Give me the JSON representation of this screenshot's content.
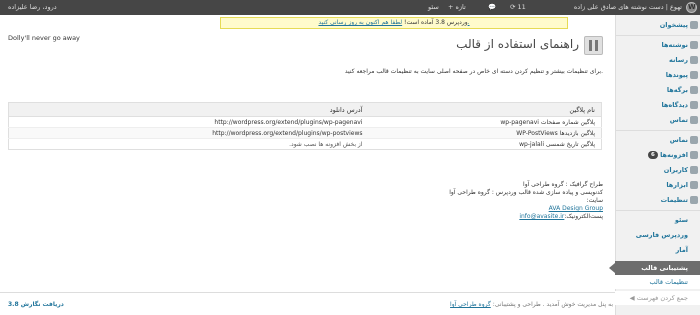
{
  "adminbar": {
    "site_name": "تهوع | دست نوشته های صادق علی زاده",
    "updates_count": "11",
    "new_label": "+ تازه",
    "seo_label": "سئو",
    "howdy": "درود، رضا علیزاده"
  },
  "notice": {
    "text": "وردپرس 3.8 آماده است!",
    "link": "لطفا هم اکنون به روز رسانی کنید."
  },
  "dolly": "Dolly'll never go away",
  "page_title": "راهنمای استفاده از قالب",
  "intro": "برای تنظیمات بیشتر و تنظیم کردن دسته ای خاص در صفحه اصلی سایت به تنظیمات قالب مراجعه کنید.",
  "table": {
    "headers": {
      "name": "نام پلاگین",
      "url": "آدرس دانلود"
    },
    "rows": [
      {
        "name": "پلاگین شماره صفحات wp-pagenavi",
        "url": "http://wordpress.org/extend/plugins/wp-pagenavi"
      },
      {
        "name": "پلاگین بازدیدها WP-PostViews",
        "url": "http://wordpress.org/extend/plugins/wp-postviews"
      },
      {
        "name": "پلاگین تاریخ شمسی wp-jalali",
        "note": "از بخش افزونه ها نصب شود."
      }
    ]
  },
  "credits": {
    "designer": "طراح گرافیک : گروه طراحی آوا",
    "coder": "کدنویسی و پیاده سازی شده قالب وردپرس : گروه طراحی آوا",
    "site_label": "سایت:",
    "site_link": "AVA Design Group",
    "email_label": "پست‌الکترونیک:",
    "email_link": "info@avasite.ir"
  },
  "menu": {
    "dashboard": "پیشخوان",
    "posts": "نوشته‌ها",
    "media": "رسانه",
    "links": "پیوندها",
    "pages": "برگه‌ها",
    "comments": "دیدگاه‌ها",
    "contact1": "تماس",
    "contact2": "نماس",
    "plugins": "افزونه‌ها",
    "plugins_badge": "6",
    "users": "کاربران",
    "tools": "ابزارها",
    "settings": "تنظیمات",
    "seo": "سئو",
    "wp_farsi": "وردپرس فارسی",
    "stats": "آمار",
    "theme_support": "پشتیبانی قالب",
    "theme_settings": "تنظیمات قالب",
    "collapse": "جمع کردن فهرست"
  },
  "footer": {
    "thanks": "به پنل مدیریت خوش آمدید . طراحی و پشتیبانی:",
    "group_link": "گروه طراحی آوا",
    "version": "دریافت نگارش 3.8"
  }
}
